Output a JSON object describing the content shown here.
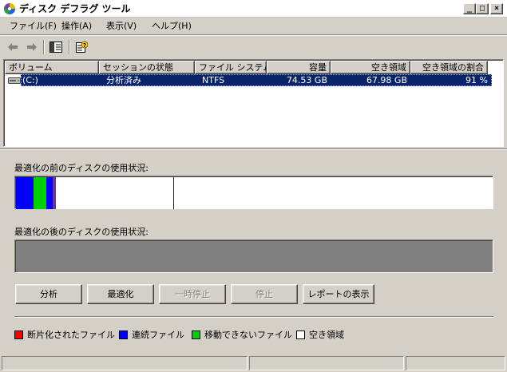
{
  "window": {
    "title": "ディスク デフラグ ツール"
  },
  "menu": {
    "file": "ファイル(F)",
    "action": "操作(A)",
    "view": "表示(V)",
    "help": "ヘルプ(H)"
  },
  "list": {
    "columns": [
      "ボリューム",
      "セッションの状態",
      "ファイル システム",
      "容量",
      "空き領域",
      "空き領域の割合"
    ],
    "rows": [
      {
        "volume": "(C:)",
        "state": "分析済み",
        "fs": "NTFS",
        "capacity": "74.53 GB",
        "free": "67.98 GB",
        "pct": "91 %"
      }
    ]
  },
  "panels": {
    "before_label": "最適化の前のディスクの使用状況:",
    "after_label": "最適化の後のディスクの使用状況:",
    "before_usage": {
      "contiguous_blue_fraction": 0.037,
      "unmovable_green_fraction": 0.026,
      "contiguous_blue2_fraction": 0.013,
      "fragmented_marker_fraction": 0.006,
      "free_fraction": 0.918
    }
  },
  "buttons": {
    "analyze": "分析",
    "defrag": "最適化",
    "pause": "一時停止",
    "stop": "停止",
    "report": "レポートの表示"
  },
  "legend": {
    "fragmented": "断片化されたファイル",
    "contiguous": "連続ファイル",
    "unmovable": "移動できないファイル",
    "free": "空き領域"
  },
  "colors": {
    "fragmented": "#ff0000",
    "contiguous": "#0000ff",
    "unmovable": "#00d000",
    "free": "#ffffff",
    "selection": "#0a246a",
    "after_fill": "#808080"
  }
}
